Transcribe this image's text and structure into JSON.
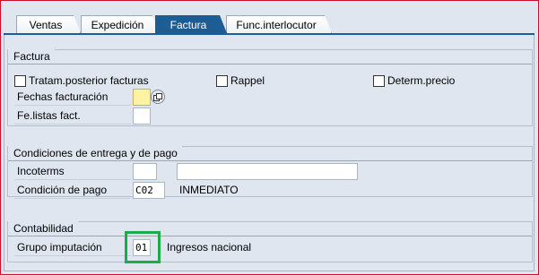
{
  "tabs": [
    {
      "label": "Ventas"
    },
    {
      "label": "Expedición"
    },
    {
      "label": "Factura"
    },
    {
      "label": "Func.interlocutor"
    }
  ],
  "factura": {
    "title": "Factura",
    "tratam_label": "Tratam.posterior facturas",
    "rappel_label": "Rappel",
    "determ_label": "Determ.precio",
    "fechas_label": "Fechas facturación",
    "fechas_value": "",
    "felistas_label": "Fe.listas fact.",
    "felistas_value": ""
  },
  "condiciones": {
    "title": "Condiciones de entrega y de pago",
    "incoterms_label": "Incoterms",
    "incoterms_value": "",
    "incoterms2_value": "",
    "condpago_label": "Condición de pago",
    "condpago_value": "C02",
    "condpago_text": "INMEDIATO"
  },
  "contabilidad": {
    "title": "Contabilidad",
    "grupo_label": "Grupo imputación",
    "grupo_value": "01",
    "grupo_text": "Ingresos nacional"
  },
  "colors": {
    "tab_active": "#1d5d94",
    "highlight": "#1daa4a",
    "required_field": "#fdf3a0"
  }
}
